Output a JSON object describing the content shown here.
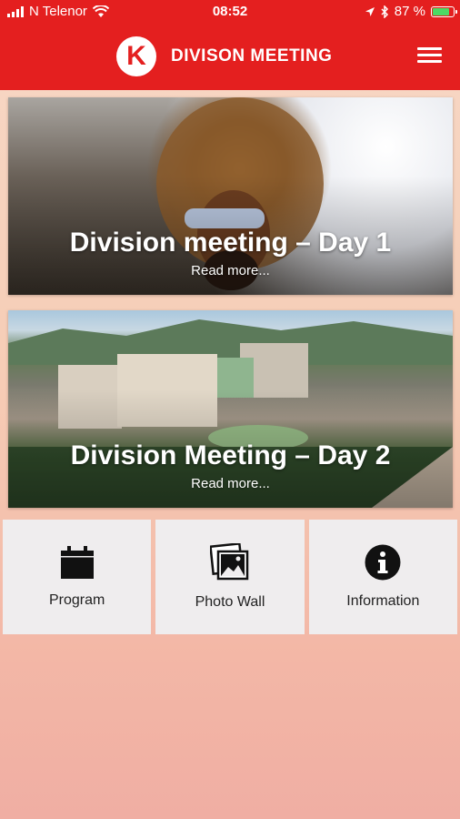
{
  "status": {
    "carrier": "N Telenor",
    "time": "08:52",
    "battery": "87 %",
    "battery_level": 0.87
  },
  "header": {
    "logo_letter": "K",
    "title": "DIVISON MEETING",
    "menu_icon": "hamburger-menu-icon"
  },
  "cards": [
    {
      "title": "Division meeting – Day 1",
      "more": "Read more..."
    },
    {
      "title": "Division Meeting – Day 2",
      "more": "Read more..."
    }
  ],
  "tiles": [
    {
      "label": "Program",
      "icon": "calendar-icon"
    },
    {
      "label": "Photo Wall",
      "icon": "photo-stack-icon"
    },
    {
      "label": "Information",
      "icon": "info-icon"
    }
  ],
  "colors": {
    "brand_red": "#e41f1f",
    "tile_background": "#efedee"
  }
}
